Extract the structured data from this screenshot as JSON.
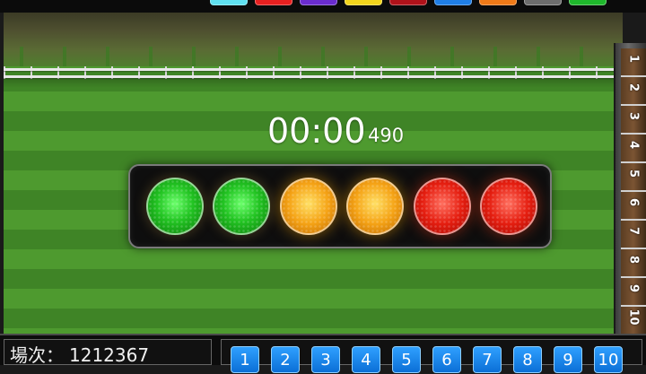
{
  "header": {
    "logo_text": "",
    "color_swatches": [
      {
        "name": "cyan",
        "color": "#5fe0f0"
      },
      {
        "name": "red",
        "color": "#e82020"
      },
      {
        "name": "purple",
        "color": "#6a2ccf"
      },
      {
        "name": "yellow",
        "color": "#f3d51c"
      },
      {
        "name": "dark-red",
        "color": "#b0121a"
      },
      {
        "name": "blue",
        "color": "#1f7ee6"
      },
      {
        "name": "orange",
        "color": "#f07a18"
      },
      {
        "name": "gray",
        "color": "#6d6d6d"
      },
      {
        "name": "green",
        "color": "#1fb82c"
      }
    ]
  },
  "race": {
    "timer": "00:00",
    "round_number": "490",
    "lights": [
      "green",
      "green",
      "orange",
      "orange",
      "red",
      "red"
    ],
    "gate_numbers": [
      "1",
      "2",
      "3",
      "4",
      "5",
      "6",
      "7",
      "8",
      "9",
      "10"
    ]
  },
  "footer": {
    "round_label": "場次：",
    "round_value": "1212367",
    "numbers": [
      "1",
      "2",
      "3",
      "4",
      "5",
      "6",
      "7",
      "8",
      "9",
      "10"
    ]
  },
  "colors": {
    "turf_light": "#4e9a2f",
    "turf_dark": "#3f8426",
    "button_blue": "#1a86ee"
  }
}
